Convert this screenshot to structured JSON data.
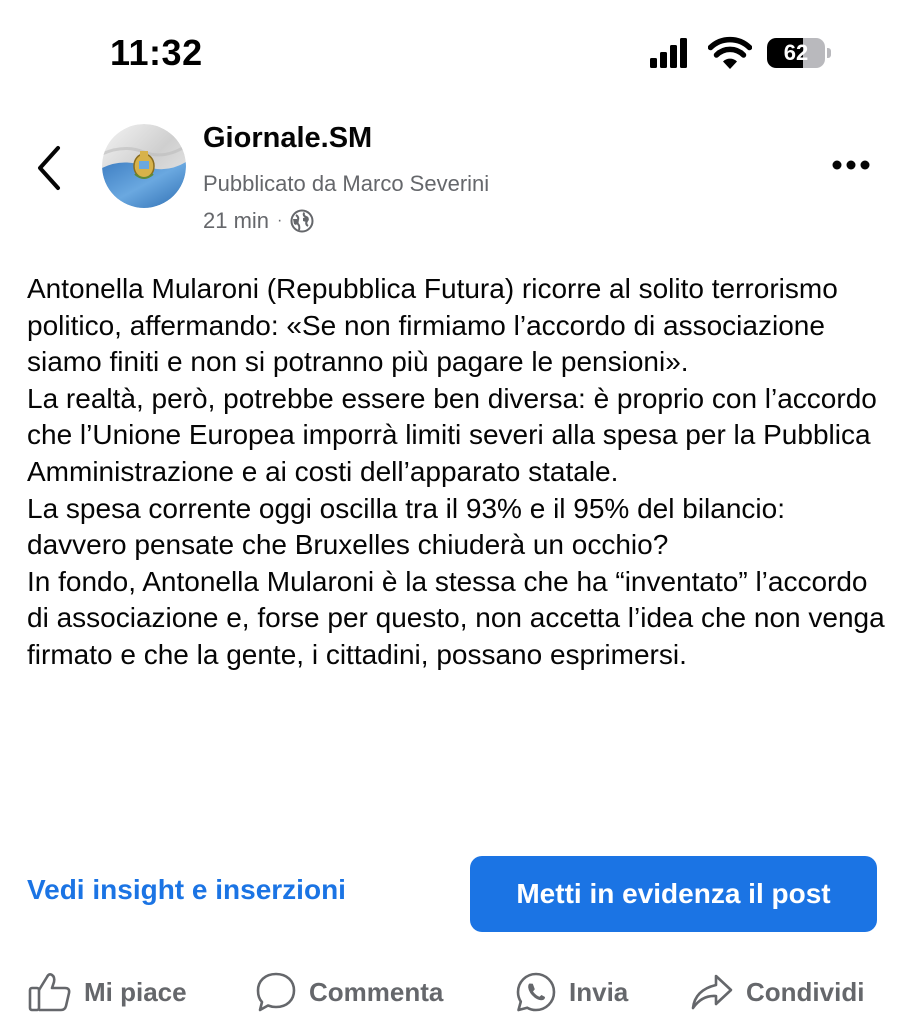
{
  "status_bar": {
    "time": "11:32",
    "battery_level": "62",
    "battery_fraction": 0.62,
    "icons": [
      "cellular-signal-icon",
      "wifi-icon",
      "battery-icon"
    ]
  },
  "header": {
    "back_icon": "chevron-left-icon",
    "page_name": "Giornale.SM",
    "publisher": "Pubblicato da Marco Severini",
    "time_ago": "21 min",
    "separator": "·",
    "visibility_icon": "globe-icon",
    "more_icon": "more-horizontal-icon"
  },
  "post": {
    "paragraphs": [
      "Antonella Mularoni (Repubblica Futura) ricorre al solito terrorismo politico, affermando: «Se non firmiamo l’accordo di associazione siamo finiti e non si potranno più pagare le pensioni».",
      "La realtà, però, potrebbe essere ben diversa: è proprio con l’accordo che l’Unione Europea imporrà limiti severi alla spesa per la Pubblica Amministrazione e ai costi dell’apparato statale.",
      "La spesa corrente oggi oscilla tra il 93% e il 95% del bilancio: davvero pensate che Bruxelles chiuderà un occhio?",
      "In fondo, Antonella Mularoni è la stessa che ha “inventato” l’accordo di associazione e, forse per questo, non accetta l’idea che non venga firmato e che la gente, i cittadini, possano esprimersi."
    ]
  },
  "actions": {
    "insights_label": "Vedi insight e inserzioni",
    "boost_label": "Metti in evidenza il post"
  },
  "reactions": {
    "like_label": "Mi piace",
    "comment_label": "Commenta",
    "send_label": "Invia",
    "share_label": "Condividi"
  },
  "colors": {
    "accent_blue": "#1b74e4",
    "secondary_text": "#65676b",
    "primary_text": "#050505"
  }
}
